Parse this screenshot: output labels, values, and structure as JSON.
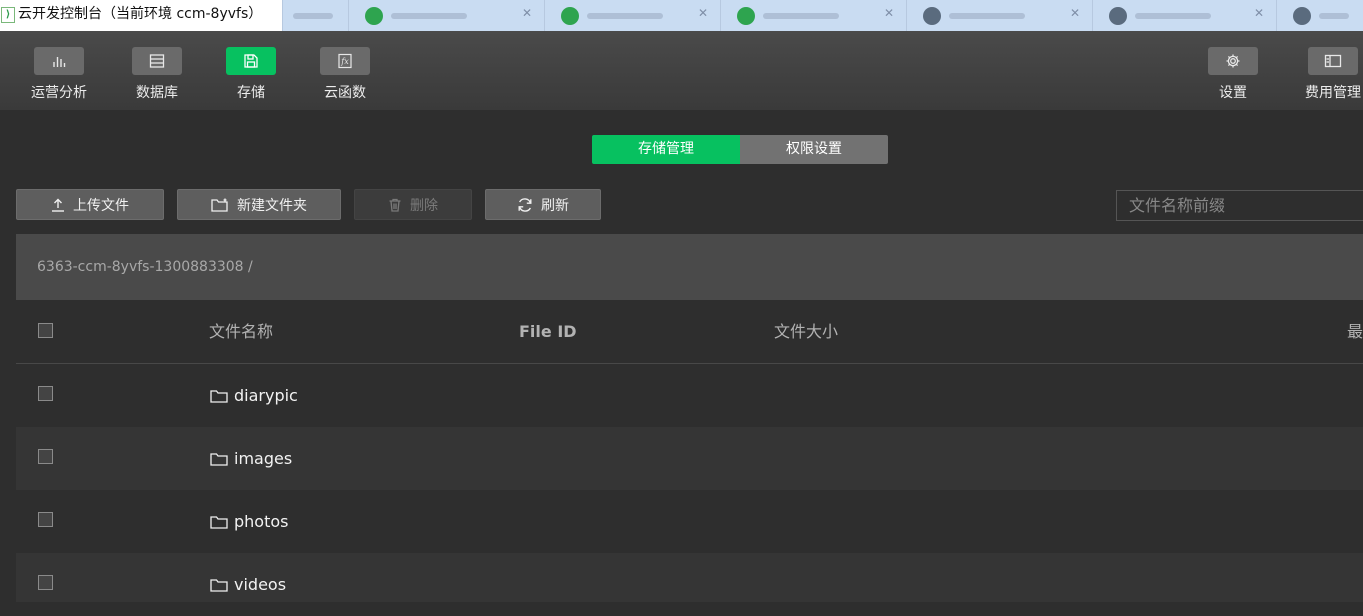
{
  "window": {
    "title": "云开发控制台（当前环境 ccm-8yvfs）",
    "logo_glyph": "⟩",
    "tab_colors": [
      "#2ea44f",
      "#2ea44f",
      "#2ea44f",
      "#5a6b7e",
      "#5a6b7e",
      "#5a6b7e"
    ]
  },
  "toolbar": {
    "left_items": [
      {
        "label": "运营分析",
        "icon": "bar-chart-icon",
        "active": false
      },
      {
        "label": "数据库",
        "icon": "database-icon",
        "active": false
      },
      {
        "label": "存储",
        "icon": "floppy-disk-icon",
        "active": true
      },
      {
        "label": "云函数",
        "icon": "function-icon",
        "active": false
      }
    ],
    "right_items": [
      {
        "label": "设置",
        "icon": "gear-icon"
      },
      {
        "label": "费用管理",
        "icon": "billing-icon"
      }
    ]
  },
  "tabs": {
    "active": "存储管理",
    "inactive": "权限设置"
  },
  "actions": {
    "upload": "上传文件",
    "new_folder": "新建文件夹",
    "delete": "删除",
    "refresh": "刷新"
  },
  "search": {
    "placeholder": "文件名称前缀"
  },
  "breadcrumb": {
    "path": "6363-ccm-8yvfs-1300883308 /"
  },
  "table": {
    "columns": [
      "文件名称",
      "File ID",
      "文件大小",
      "最"
    ],
    "rows": [
      {
        "name": "diarypic"
      },
      {
        "name": "images"
      },
      {
        "name": "photos"
      },
      {
        "name": "videos"
      }
    ]
  },
  "colors": {
    "accent": "#07c160",
    "toolbar_bg": "#444444",
    "page_bg": "#2e2e2e"
  }
}
